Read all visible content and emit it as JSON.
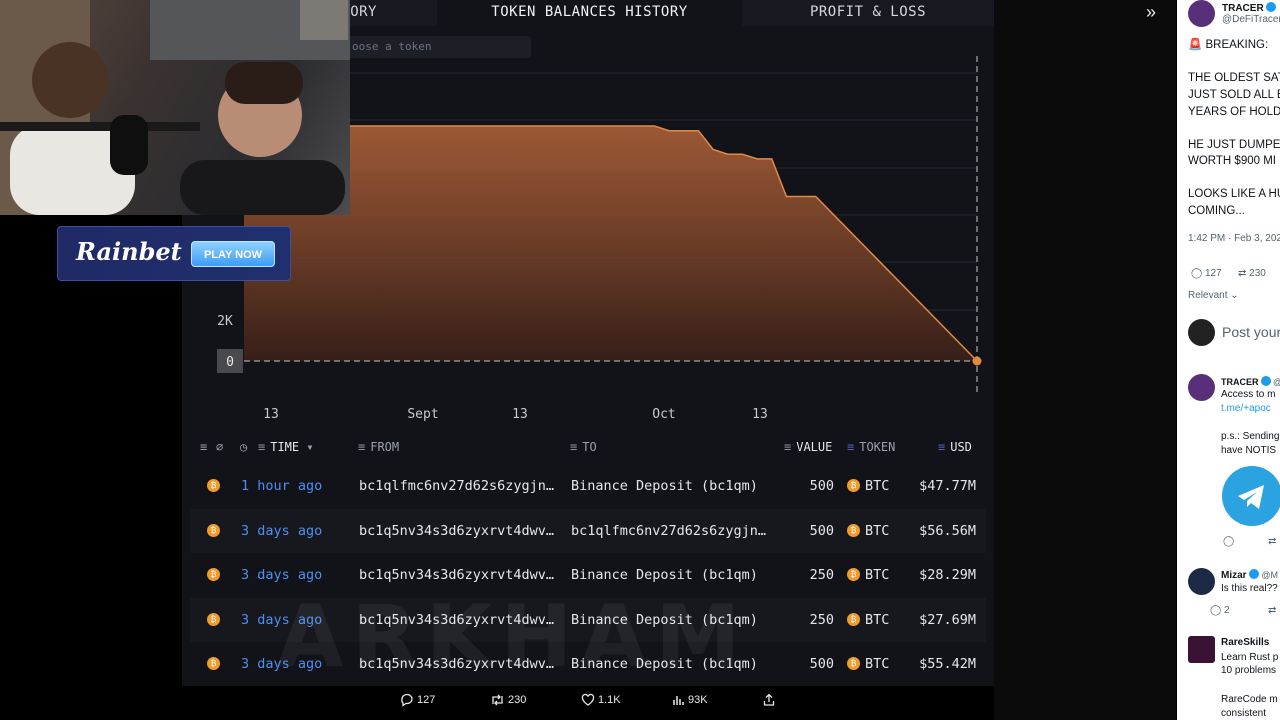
{
  "arkham": {
    "tabs": {
      "history": "ORY",
      "balances": "TOKEN BALANCES HISTORY",
      "pnl": "PROFIT & LOSS"
    },
    "token_select_placeholder": "oose a token",
    "watermark": "ARKHAM",
    "table": {
      "headers": {
        "time": "TIME",
        "from": "FROM",
        "to": "TO",
        "value": "VALUE",
        "token": "TOKEN",
        "usd": "USD"
      },
      "rows": [
        {
          "time": "1 hour ago",
          "from": "bc1qlfmc6nv27d62s6zygjn…",
          "to": "Binance Deposit (bc1qm)",
          "value": "500",
          "token": "BTC",
          "usd": "$47.77M"
        },
        {
          "time": "3 days ago",
          "from": "bc1q5nv34s3d6zyxrvt4dwv…",
          "to": "bc1qlfmc6nv27d62s6zygjn…",
          "value": "500",
          "token": "BTC",
          "usd": "$56.56M"
        },
        {
          "time": "3 days ago",
          "from": "bc1q5nv34s3d6zyxrvt4dwv…",
          "to": "Binance Deposit (bc1qm)",
          "value": "250",
          "token": "BTC",
          "usd": "$28.29M"
        },
        {
          "time": "3 days ago",
          "from": "bc1q5nv34s3d6zyxrvt4dwv…",
          "to": "Binance Deposit (bc1qm)",
          "value": "250",
          "token": "BTC",
          "usd": "$27.69M"
        },
        {
          "time": "3 days ago",
          "from": "bc1q5nv34s3d6zyxrvt4dwv…",
          "to": "Binance Deposit (bc1qm)",
          "value": "500",
          "token": "BTC",
          "usd": "$55.42M"
        }
      ]
    },
    "colors": {
      "area": "#c0703a",
      "line": "#e08a45",
      "time_link": "#4e8ef0",
      "btc": "#f29b2a"
    }
  },
  "chart_data": {
    "type": "area",
    "ytick_labels": [
      "2K",
      "0"
    ],
    "xtick_labels": [
      "13",
      "Sept",
      "13",
      "Oct",
      "13"
    ],
    "series": [
      {
        "values": [
          [
            0,
            5000
          ],
          [
            0.56,
            5000
          ],
          [
            0.58,
            4900
          ],
          [
            0.62,
            4900
          ],
          [
            0.64,
            4500
          ],
          [
            0.66,
            4400
          ],
          [
            0.68,
            4400
          ],
          [
            0.7,
            4300
          ],
          [
            0.72,
            4300
          ],
          [
            0.74,
            3500
          ],
          [
            0.76,
            3500
          ],
          [
            0.78,
            3500
          ],
          [
            1.0,
            0
          ]
        ]
      }
    ]
  },
  "post_actions": {
    "replies": "127",
    "reposts": "230",
    "likes": "1.1K",
    "views": "93K"
  },
  "ad": {
    "logo": "Rainbet",
    "cta": "PLAY NOW"
  },
  "twitter": {
    "main": {
      "name": "TRACER",
      "handle": "@DeFiTracer",
      "lines": [
        "🚨 BREAKING:",
        "THE OLDEST SAT",
        "JUST SOLD ALL E",
        "YEARS OF HOLDI",
        "HE JUST DUMPEI",
        "WORTH $900 MI",
        "LOOKS LIKE A HU",
        "COMING..."
      ],
      "timestamp": "1:42 PM · Feb 3, 202",
      "replies": "127",
      "reposts": "230",
      "sort": "Relevant",
      "reply_placeholder": "Post your"
    },
    "replies": [
      {
        "name": "TRACER",
        "handle": "@",
        "text": "Access to m",
        "link": "t.me/+apoc",
        "extra1": "p.s.: Sending",
        "extra2": "have NOTIS"
      },
      {
        "name": "Mizar",
        "handle": "@M",
        "text": "Is this real??",
        "count": "2"
      },
      {
        "name": "RareSkills",
        "handle": "",
        "text": "Learn Rust p",
        "text2": "10 problems",
        "text3": "RareCode m",
        "text4": "consistent"
      }
    ]
  }
}
